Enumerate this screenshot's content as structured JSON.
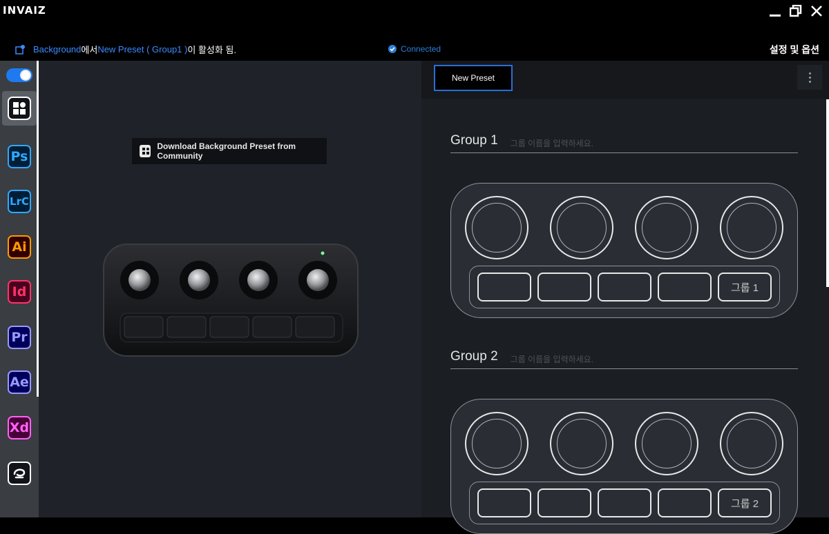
{
  "app": {
    "logo": "INVAIZ"
  },
  "status": {
    "prefix_app": "Background",
    "middle": "에서 ",
    "preset": "New Preset ( Group1 )",
    "suffix": "이 활성화 됨.",
    "connection": "Connected",
    "settings_label": "설정 및 옵션"
  },
  "sidebar": {
    "toggle_on": true,
    "apps": [
      {
        "label": "",
        "name": "background",
        "color": "#ffffff",
        "bg": "#111318",
        "border": "#ffffff"
      },
      {
        "label": "Ps",
        "name": "photoshop",
        "color": "#31a8ff",
        "bg": "#001e36",
        "border": "#31a8ff"
      },
      {
        "label": "LrC",
        "name": "lightroom-classic",
        "color": "#31a8ff",
        "bg": "#001e36",
        "border": "#31a8ff"
      },
      {
        "label": "Ai",
        "name": "illustrator",
        "color": "#ff9a00",
        "bg": "#330000",
        "border": "#ff9a00"
      },
      {
        "label": "Id",
        "name": "indesign",
        "color": "#ff3366",
        "bg": "#49021f",
        "border": "#ff3366"
      },
      {
        "label": "Pr",
        "name": "premiere-pro",
        "color": "#9999ff",
        "bg": "#00005b",
        "border": "#9999ff"
      },
      {
        "label": "Ae",
        "name": "after-effects",
        "color": "#9999ff",
        "bg": "#00005b",
        "border": "#9999ff"
      },
      {
        "label": "Xd",
        "name": "xd",
        "color": "#ff61f6",
        "bg": "#470137",
        "border": "#ff61f6"
      },
      {
        "label": "",
        "name": "clip-studio",
        "color": "#ffffff",
        "bg": "#111318",
        "border": "#ffffff"
      }
    ]
  },
  "left": {
    "download_label": "Download Background Preset from Community"
  },
  "right": {
    "preset_tab": "New Preset",
    "groups": [
      {
        "title": "Group 1",
        "placeholder": "그룹 이름을 입력하세요.",
        "key_label": "그룹 1"
      },
      {
        "title": "Group 2",
        "placeholder": "그룹 이름을 입력하세요.",
        "key_label": "그룹 2"
      }
    ]
  }
}
